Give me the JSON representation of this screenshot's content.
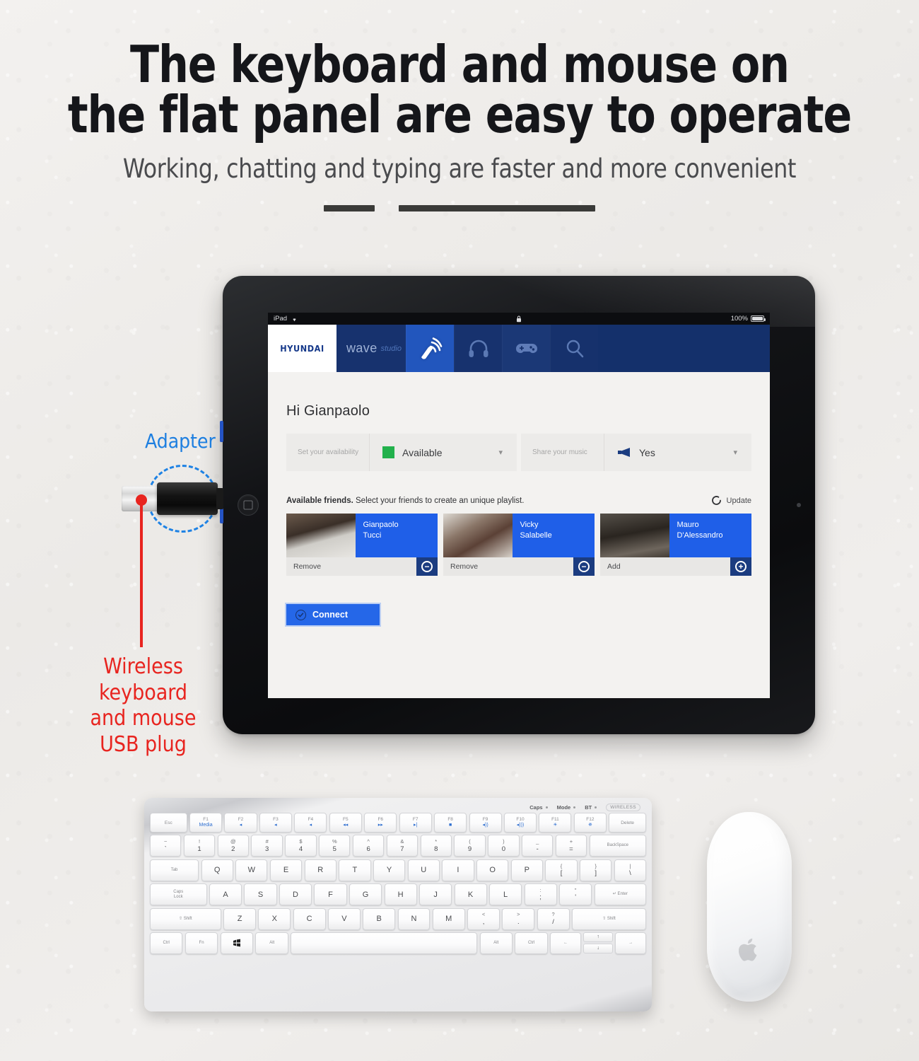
{
  "header": {
    "headline_line1": "The keyboard and mouse on",
    "headline_line2": "the flat panel are easy to operate",
    "subline": "Working, chatting and typing are faster and more convenient"
  },
  "annotations": {
    "adapter_label": "Adapter",
    "usb_label_line1": "Wireless",
    "usb_label_line2": "keyboard",
    "usb_label_line3": "and mouse",
    "usb_label_line4": "USB plug",
    "adapter_color": "#1e82e4",
    "usb_color": "#e8241f"
  },
  "tablet": {
    "status_bar": {
      "device": "iPad",
      "wifi_icon": "wifi-icon",
      "lock_icon": "lock-icon",
      "battery_percent": "100%",
      "battery_icon": "battery-icon"
    },
    "nav": {
      "logo": "HYUNDAI",
      "wave_title": "wave",
      "wave_sub": "studio",
      "tiles": [
        {
          "icon": "satellite-dish-icon",
          "active": true
        },
        {
          "icon": "headphones-icon",
          "active": false
        },
        {
          "icon": "gamepad-icon",
          "active": false
        },
        {
          "icon": "search-icon",
          "active": false
        }
      ],
      "sub_tile_icon": "target-record-icon"
    },
    "content": {
      "greeting": "Hi Gianpaolo",
      "settings": [
        {
          "label": "Set your availability",
          "value": "Available",
          "indicator": "green-square",
          "caret": "chevron-down-icon"
        },
        {
          "label": "Share your music",
          "value": "Yes",
          "indicator": "megaphone-icon",
          "caret": "chevron-down-icon"
        }
      ],
      "friends_heading_bold": "Available friends.",
      "friends_heading_rest": " Select your friends to create an unique playlist.",
      "update_label": "Update",
      "update_icon": "refresh-icon",
      "friends": [
        {
          "first": "Gianpaolo",
          "last": "Tucci",
          "action": "Remove",
          "button": "minus-icon"
        },
        {
          "first": "Vicky",
          "last": "Salabelle",
          "action": "Remove",
          "button": "minus-icon"
        },
        {
          "first": "Mauro",
          "last": "D'Alessandro",
          "action": "Add",
          "button": "plus-icon"
        }
      ],
      "connect_label": "Connect",
      "connect_icon": "check-circle-icon"
    },
    "accent_blue": "#2567e8",
    "nav_blue": "#14306b"
  },
  "keyboard": {
    "indicators": [
      {
        "label": "Caps"
      },
      {
        "label": "Mode"
      },
      {
        "label": "BT"
      }
    ],
    "brand": "WIRELESS",
    "fn_row": [
      "Esc",
      "F1",
      "F2",
      "F3",
      "F4",
      "F5",
      "F6",
      "F7",
      "F8",
      "F9",
      "F10",
      "F11",
      "F12",
      "Delete"
    ],
    "fn_row_sub": [
      "",
      "Media",
      "◂",
      "◂",
      "◂",
      "◂◂",
      "▸▸",
      "▸|",
      "■",
      "◂))",
      "◂)))",
      "☀",
      "✵",
      ""
    ],
    "num_row": [
      {
        "top": "~",
        "bot": "`"
      },
      {
        "top": "!",
        "bot": "1"
      },
      {
        "top": "@",
        "bot": "2"
      },
      {
        "top": "#",
        "bot": "3"
      },
      {
        "top": "$",
        "bot": "4"
      },
      {
        "top": "%",
        "bot": "5"
      },
      {
        "top": "^",
        "bot": "6"
      },
      {
        "top": "&",
        "bot": "7"
      },
      {
        "top": "*",
        "bot": "8"
      },
      {
        "top": "(",
        "bot": "9"
      },
      {
        "top": ")",
        "bot": "0"
      },
      {
        "top": "_",
        "bot": "-"
      },
      {
        "top": "+",
        "bot": "="
      }
    ],
    "backspace": "BackSpace",
    "tab": "Tab",
    "qwerty": [
      "Q",
      "W",
      "E",
      "R",
      "T",
      "Y",
      "U",
      "I",
      "O",
      "P"
    ],
    "qwerty_extra": [
      {
        "top": "{",
        "bot": "["
      },
      {
        "top": "}",
        "bot": "]"
      },
      {
        "top": "|",
        "bot": "\\"
      }
    ],
    "caps_lock_line1": "Caps",
    "caps_lock_line2": "Lock",
    "asdf": [
      "A",
      "S",
      "D",
      "F",
      "G",
      "H",
      "J",
      "K",
      "L"
    ],
    "asdf_extra": [
      {
        "top": ":",
        "bot": ";"
      },
      {
        "top": "\"",
        "bot": "'"
      }
    ],
    "enter": "Enter",
    "shift": "Shift",
    "zxcv": [
      "Z",
      "X",
      "C",
      "V",
      "B",
      "N",
      "M"
    ],
    "zxcv_extra": [
      {
        "top": "<",
        "bot": ","
      },
      {
        "top": ">",
        "bot": "."
      },
      {
        "top": "?",
        "bot": "/"
      }
    ],
    "ctrl": "Ctrl",
    "fn": "Fn",
    "win": "win-logo-icon",
    "alt": "Alt",
    "space": "",
    "arrow_left": "←",
    "arrow_up": "↑",
    "arrow_down": "↓",
    "arrow_right": "→"
  },
  "mouse": {
    "logo_icon": "apple-logo-icon"
  }
}
